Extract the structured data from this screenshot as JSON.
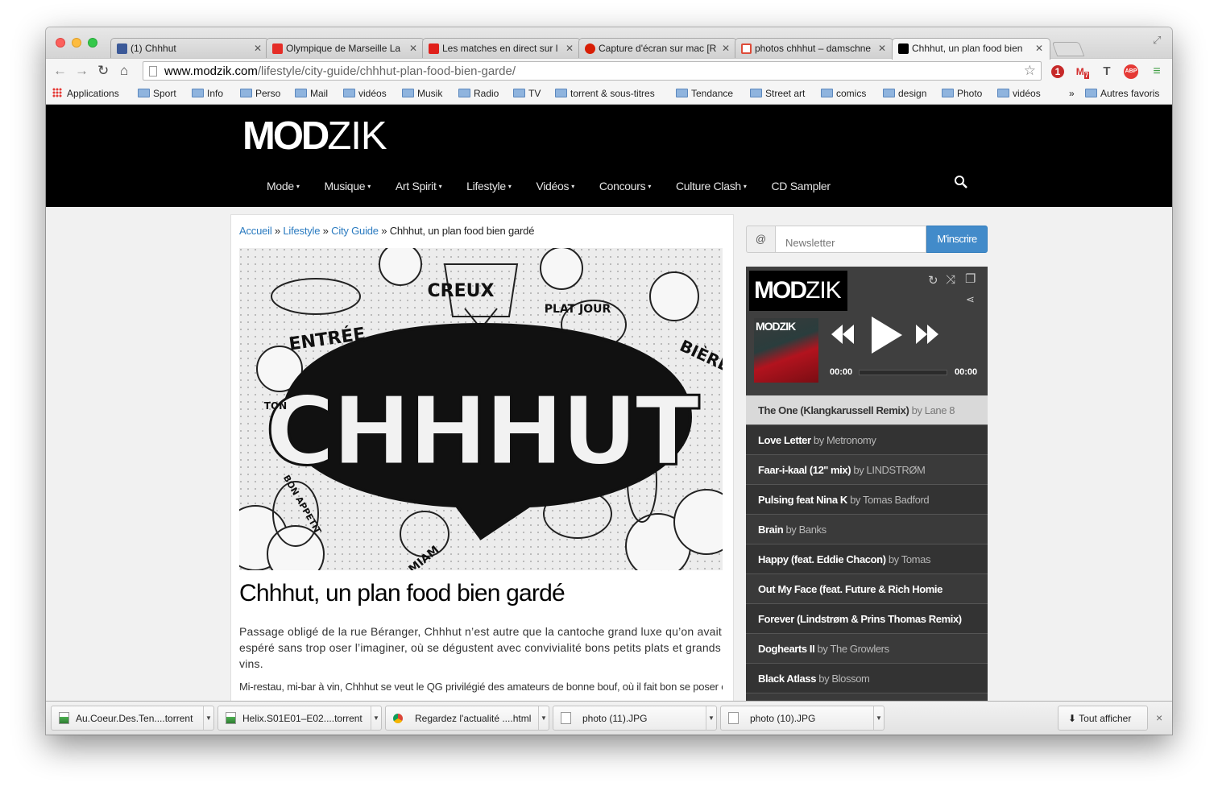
{
  "browser": {
    "tabs": [
      {
        "label": "(1) Chhhut",
        "favicon_color": "#3b5998",
        "icon": "facebook-icon"
      },
      {
        "label": "Olympique de Marseille La",
        "favicon_color": "#e52d27",
        "icon": "youtube-icon"
      },
      {
        "label": "Les matches en direct sur l",
        "favicon_color": "#e0201b",
        "icon": "lequipe-icon"
      },
      {
        "label": "Capture d'écran sur mac [R",
        "favicon_color": "#d81e05",
        "icon": "question-icon"
      },
      {
        "label": "photos chhhut – damschne",
        "favicon_color": "#dd4b39",
        "icon": "gmail-icon"
      },
      {
        "label": "Chhhut, un plan food bien",
        "favicon_color": "#000000",
        "icon": "modzik-icon"
      }
    ],
    "url_host": "www.modzik.com",
    "url_path": "/lifestyle/city-guide/chhhut-plan-food-bien-garde/",
    "extensions": {
      "gmail_badge": "7",
      "opera_badge": "1",
      "t_label": "T",
      "abp_label": "ABP"
    },
    "bookmarks": [
      "Applications",
      "Sport",
      "Info",
      "Perso",
      "Mail",
      "vidéos",
      "Musik",
      "Radio",
      "TV",
      "torrent & sous-titres",
      "Tendance",
      "Street art",
      "comics",
      "design",
      "Photo",
      "vidéos"
    ],
    "bookmarks_overflow": "»",
    "other_bookmarks": "Autres favoris"
  },
  "site": {
    "logo_bold": "MOD",
    "logo_light": "ZIK",
    "nav": [
      "Mode",
      "Musique",
      "Art Spirit",
      "Lifestyle",
      "Vidéos",
      "Concours",
      "Culture Clash",
      "CD Sampler"
    ],
    "nav_caret": "▾"
  },
  "article": {
    "breadcrumb": {
      "home": "Accueil",
      "section": "Lifestyle",
      "subsection": "City Guide",
      "current": "Chhhut, un plan food bien gardé",
      "sep": " » "
    },
    "hero_text": {
      "main": "CHHHUT",
      "creux": "CREUX",
      "entree": "ENTRÉE",
      "plat": "PLAT JOUR",
      "biere": "BIÈRE",
      "bon": "BON APPETIT",
      "miam": "MIAM",
      "ton": "TON"
    },
    "title": "Chhhut, un plan food bien gardé",
    "p1": "Passage obligé de la rue Béranger, Chhhut n’est autre que la cantoche grand luxe qu’on avait espéré sans trop oser l’imaginer, où se dégustent avec convivialité bons petits plats et grands vins.",
    "p2": "Mi-restau, mi-bar à vin, Chhhut se veut le QG privilégié des amateurs de bonne bouf, où il fait bon se poser entre"
  },
  "sidebar": {
    "newsletter": {
      "at": "@",
      "placeholder": "Newsletter",
      "button": "M'inscrire"
    },
    "player": {
      "logo_bold": "MOD",
      "logo_light": "ZIK",
      "cover_label": "MODZIK",
      "time_elapsed": "00:00",
      "time_total": "00:00",
      "tracks": [
        {
          "title": "The One (Klangkarussell Remix)",
          "artist": "by Lane 8"
        },
        {
          "title": "Love Letter",
          "artist": "by Metronomy"
        },
        {
          "title": "Faar-i-kaal (12'' mix)",
          "artist": "by LINDSTRØM"
        },
        {
          "title": "Pulsing feat Nina K",
          "artist": "by Tomas Badford"
        },
        {
          "title": "Brain",
          "artist": "by Banks"
        },
        {
          "title": "Happy (feat. Eddie Chacon)",
          "artist": "by Tomas"
        },
        {
          "title": "Out My Face (feat. Future & Rich Homie",
          "artist": ""
        },
        {
          "title": "Forever (Lindstrøm & Prins Thomas Remix)",
          "artist": ""
        },
        {
          "title": "Doghearts II",
          "artist": "by The Growlers"
        },
        {
          "title": "Black Atlass",
          "artist": "by Blossom"
        }
      ]
    }
  },
  "downloads": {
    "items": [
      "Au.Coeur.Des.Ten....torrent",
      "Helix.S01E01–E02....torrent",
      "Regardez l'actualité ....html",
      "photo (11).JPG",
      "photo (10).JPG"
    ],
    "show_all": "Tout afficher",
    "close": "×"
  }
}
